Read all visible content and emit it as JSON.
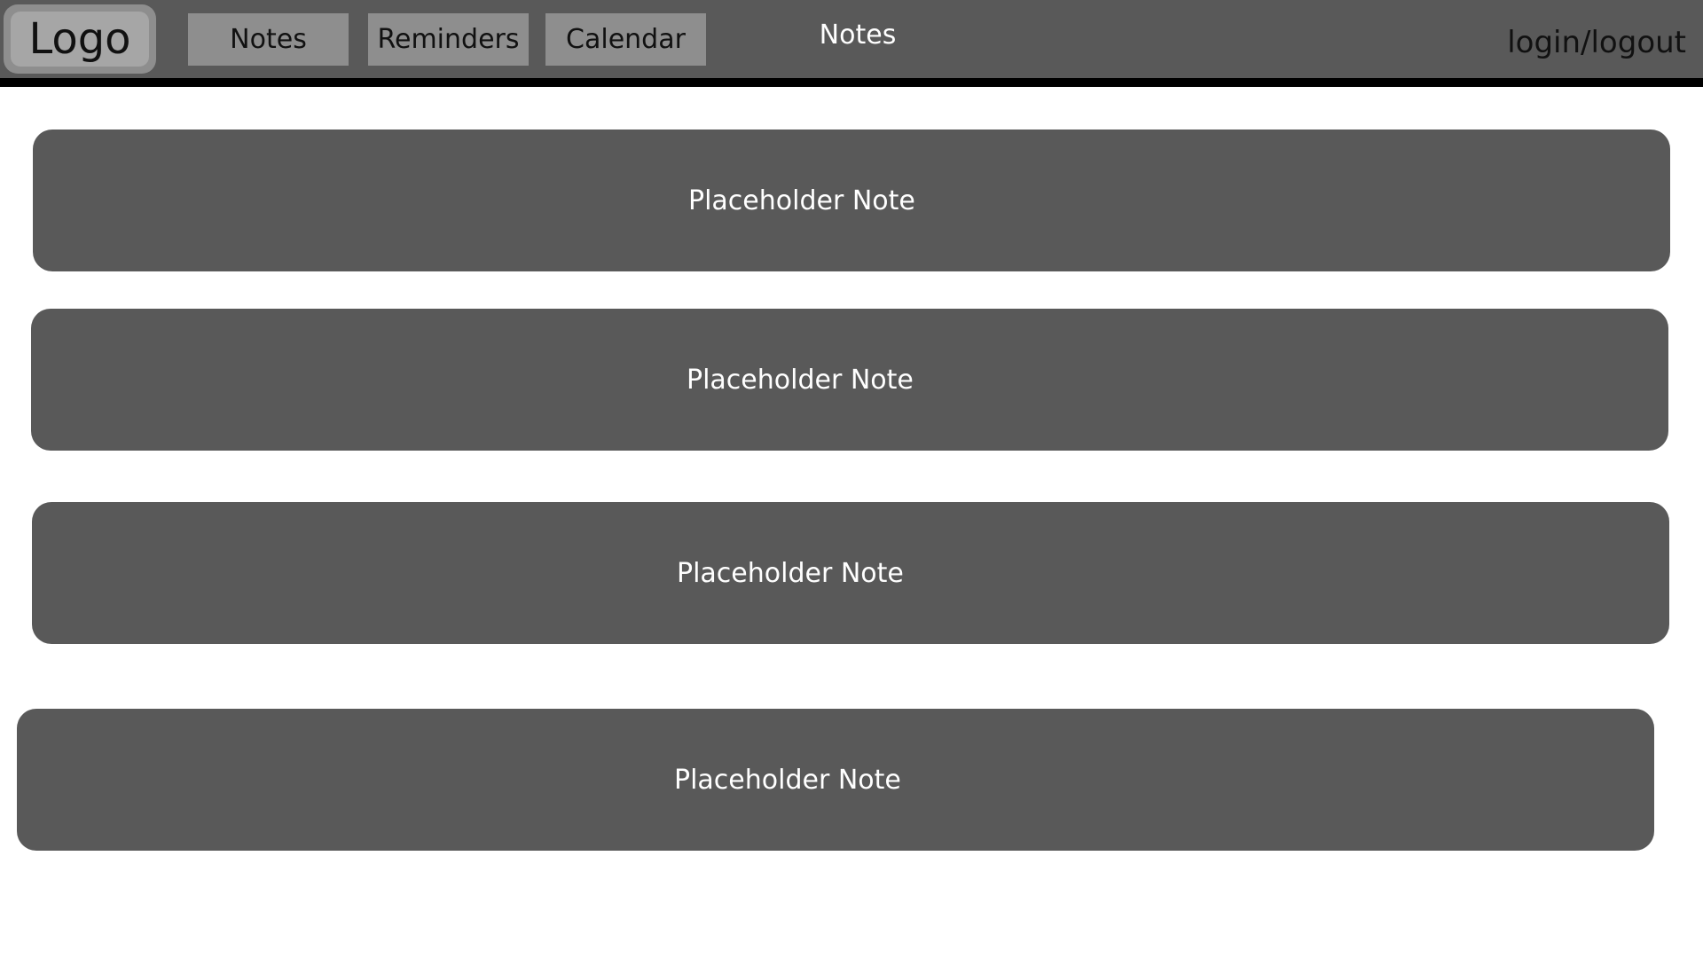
{
  "header": {
    "logo_label": "Logo",
    "nav": [
      {
        "label": "Notes"
      },
      {
        "label": "Reminders"
      },
      {
        "label": "Calendar"
      }
    ],
    "page_title": "Notes",
    "auth_label": "login/logout"
  },
  "notes": [
    {
      "text": "Placeholder Note"
    },
    {
      "text": "Placeholder Note"
    },
    {
      "text": "Placeholder Note"
    },
    {
      "text": "Placeholder Note"
    }
  ],
  "colors": {
    "header_bg": "#595959",
    "header_border": "#000000",
    "button_bg": "#8e8e8e",
    "note_bg": "#595959",
    "page_bg": "#ffffff"
  }
}
